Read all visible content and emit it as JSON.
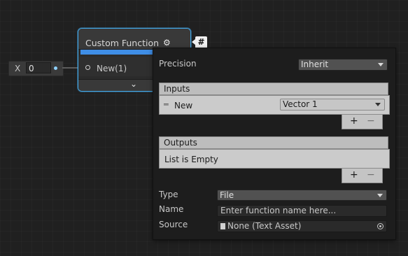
{
  "input_node": {
    "label": "X",
    "value": "0"
  },
  "custom_function_node": {
    "title": "Custom Function",
    "input_port_label": "New(1)",
    "expand_glyph": "⌄",
    "settings_icon": "gear-refresh-icon"
  },
  "hash_button": {
    "label": "#"
  },
  "panel": {
    "precision": {
      "label": "Precision",
      "value": "Inherit"
    },
    "inputs": {
      "header": "Inputs",
      "items": [
        {
          "name": "New",
          "type": "Vector 1"
        }
      ]
    },
    "outputs": {
      "header": "Outputs",
      "empty_text": "List is Empty"
    },
    "plus_label": "+",
    "minus_label": "−",
    "type": {
      "label": "Type",
      "value": "File"
    },
    "name": {
      "label": "Name",
      "placeholder": "Enter function name here..."
    },
    "source": {
      "label": "Source",
      "value": "None (Text Asset)"
    }
  },
  "colors": {
    "selection_outline": "#44a8e8",
    "precision_bar": "#3f8ee6",
    "port_vector1": "#8fd2ff"
  }
}
